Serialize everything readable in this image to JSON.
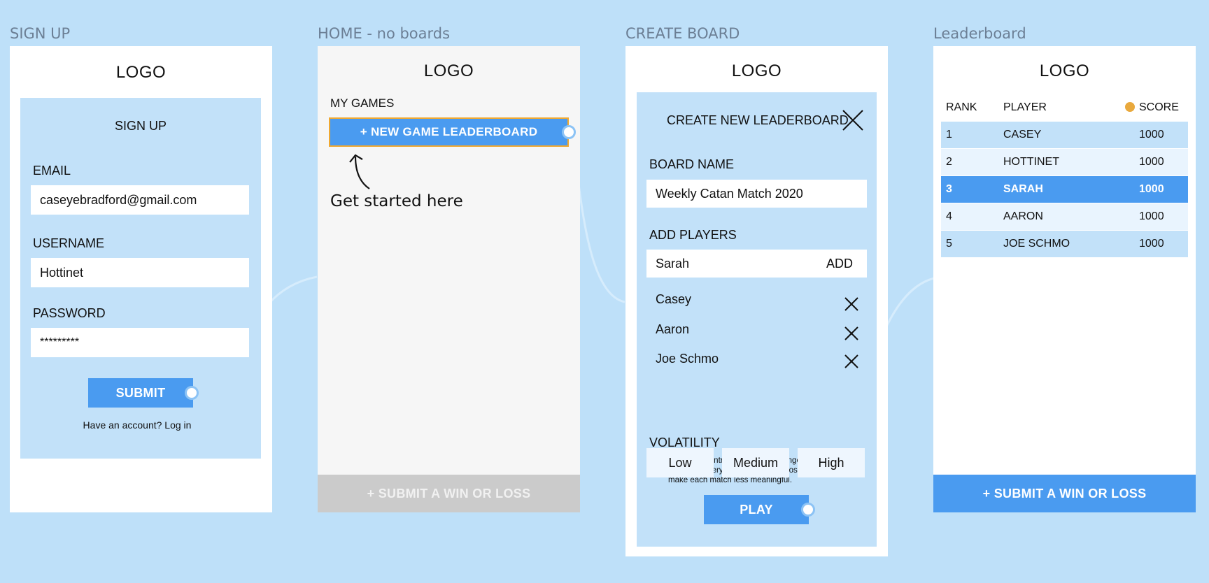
{
  "frames": {
    "signup": {
      "title": "SIGN UP",
      "logo": "LOGO",
      "heading": "SIGN UP",
      "email_label": "EMAIL",
      "email_value": "caseyebradford@gmail.com",
      "username_label": "USERNAME",
      "username_value": "Hottinet",
      "password_label": "PASSWORD",
      "password_value": "*********",
      "submit_label": "SUBMIT",
      "login_text": "Have an account? Log in"
    },
    "home": {
      "title": "HOME - no boards",
      "logo": "LOGO",
      "my_games_label": "MY GAMES",
      "new_game_label": "+ NEW GAME LEADERBOARD",
      "hint": "Get started here",
      "submit_label": "+ SUBMIT A WIN OR LOSS"
    },
    "create": {
      "title": "CREATE BOARD",
      "logo": "LOGO",
      "heading": "CREATE NEW LEADERBOARD",
      "board_name_label": "BOARD NAME",
      "board_name_value": "Weekly Catan Match 2020",
      "add_players_label": "ADD PLAYERS",
      "add_player_value": "Sarah",
      "add_label": "ADD",
      "players": [
        "Casey",
        "Aaron",
        "Joe Schmo"
      ],
      "volatility_label": "VOLATILITY",
      "volatility_note": "“Volatility” controls how much change happens based on every win and loss. Choosing”low” will make each match less meaningful.",
      "volatility_options": [
        "Low",
        "Medium",
        "High"
      ],
      "play_label": "PLAY"
    },
    "leaderboard": {
      "title": "Leaderboard",
      "logo": "LOGO",
      "headers": {
        "rank": "RANK",
        "player": "PLAYER",
        "score": "SCORE"
      },
      "rows": [
        {
          "rank": "1",
          "player": "CASEY",
          "score": "1000"
        },
        {
          "rank": "2",
          "player": "HOTTINET",
          "score": "1000"
        },
        {
          "rank": "3",
          "player": "SARAH",
          "score": "1000"
        },
        {
          "rank": "4",
          "player": "AARON",
          "score": "1000"
        },
        {
          "rank": "5",
          "player": "JOE SCHMO",
          "score": "1000"
        }
      ],
      "highlighted_row": 3,
      "submit_label": "+ SUBMIT A WIN OR LOSS"
    }
  },
  "colors": {
    "canvas": "#bee0f9",
    "panel": "#c2e1f9",
    "accent": "#4a9bf0",
    "highlight_border": "#f0a830",
    "info_dot": "#e9a93d",
    "disabled": "#cbcbcb"
  },
  "icons": {
    "close": "close-icon",
    "arrow": "curved-arrow-icon",
    "info": "info-dot-icon",
    "handle": "connector-handle-icon"
  }
}
